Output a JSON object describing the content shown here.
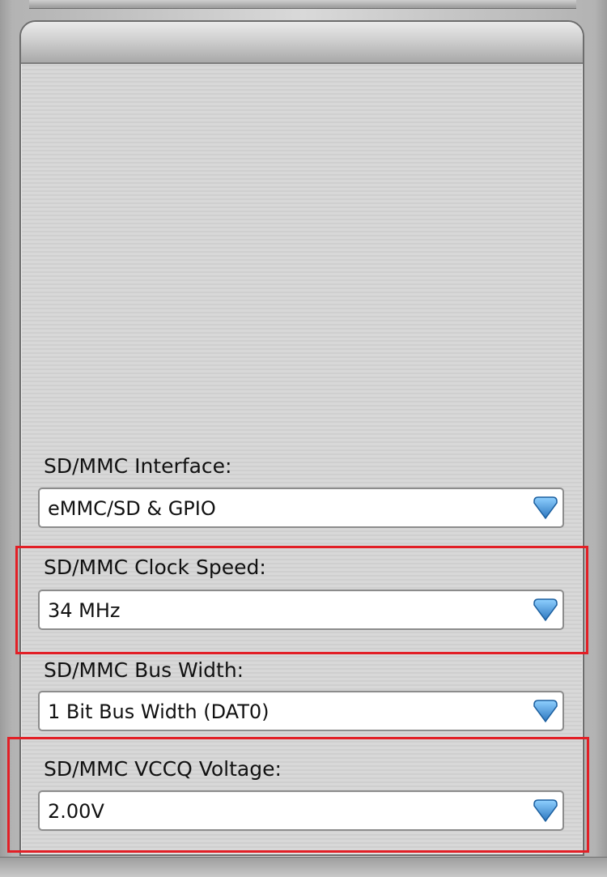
{
  "fields": [
    {
      "label": "SD/MMC Interface:",
      "value": "eMMC/SD & GPIO",
      "highlighted": false
    },
    {
      "label": "SD/MMC Clock Speed:",
      "value": "34 MHz",
      "highlighted": true
    },
    {
      "label": "SD/MMC Bus Width:",
      "value": "1 Bit Bus Width (DAT0)",
      "highlighted": false
    },
    {
      "label": "SD/MMC VCCQ Voltage:",
      "value": "2.00V",
      "highlighted": true
    }
  ],
  "colors": {
    "highlight": "#e21f26",
    "arrow": "#3a8fd1"
  },
  "icons": {
    "dropdown": "chevron-down-icon"
  }
}
